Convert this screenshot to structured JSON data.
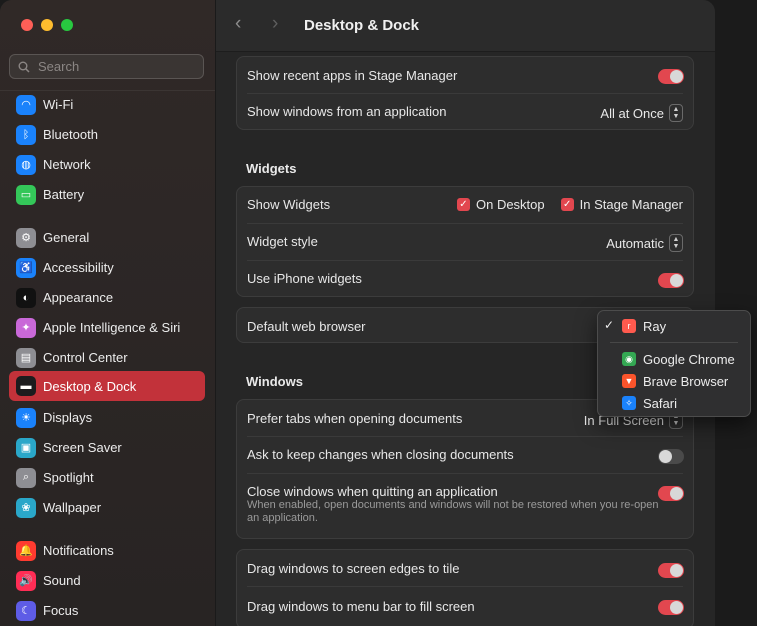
{
  "window": {
    "title": "Desktop & Dock"
  },
  "sidebar": {
    "search_placeholder": "Search",
    "items": [
      {
        "label": "Wi-Fi",
        "icon": "wifi-icon",
        "color": "#1a82fb",
        "glyph": "◠"
      },
      {
        "label": "Bluetooth",
        "icon": "bluetooth-icon",
        "color": "#1a82fb",
        "glyph": "ᛒ"
      },
      {
        "label": "Network",
        "icon": "globe-icon",
        "color": "#1a82fb",
        "glyph": "◍"
      },
      {
        "label": "Battery",
        "icon": "battery-icon",
        "color": "#34c759",
        "glyph": "▭"
      },
      {
        "label": "General",
        "icon": "gear-icon",
        "color": "#8e8e93",
        "glyph": "⚙"
      },
      {
        "label": "Accessibility",
        "icon": "accessibility-icon",
        "color": "#1a82fb",
        "glyph": "♿"
      },
      {
        "label": "Appearance",
        "icon": "appearance-icon",
        "color": "#111111",
        "glyph": "◐"
      },
      {
        "label": "Apple Intelligence & Siri",
        "icon": "siri-icon",
        "color": "#c968d8",
        "glyph": "✦"
      },
      {
        "label": "Control Center",
        "icon": "control-center-icon",
        "color": "#8e8e93",
        "glyph": "▤"
      },
      {
        "label": "Desktop & Dock",
        "icon": "dock-icon",
        "color": "#1c1c1e",
        "glyph": "▬"
      },
      {
        "label": "Displays",
        "icon": "displays-icon",
        "color": "#1a82fb",
        "glyph": "☀"
      },
      {
        "label": "Screen Saver",
        "icon": "screen-saver-icon",
        "color": "#2aa7c9",
        "glyph": "▣"
      },
      {
        "label": "Spotlight",
        "icon": "spotlight-icon",
        "color": "#8e8e93",
        "glyph": "⌕"
      },
      {
        "label": "Wallpaper",
        "icon": "wallpaper-icon",
        "color": "#2aa7c9",
        "glyph": "❀"
      },
      {
        "label": "Notifications",
        "icon": "notifications-icon",
        "color": "#ff3b30",
        "glyph": "🔔"
      },
      {
        "label": "Sound",
        "icon": "sound-icon",
        "color": "#ff2d55",
        "glyph": "🔊"
      },
      {
        "label": "Focus",
        "icon": "focus-icon",
        "color": "#5e5ce6",
        "glyph": "☾"
      }
    ],
    "selected": "Desktop & Dock"
  },
  "stage_group": {
    "rows": [
      {
        "label": "Show recent apps in Stage Manager",
        "toggle": true
      },
      {
        "label": "Show windows from an application",
        "popup": "All at Once"
      }
    ]
  },
  "widgets": {
    "title": "Widgets",
    "show_widgets_label": "Show Widgets",
    "on_desktop_label": "On Desktop",
    "in_stage_manager_label": "In Stage Manager",
    "on_desktop_checked": true,
    "in_stage_manager_checked": true,
    "widget_style_label": "Widget style",
    "widget_style_value": "Automatic",
    "iphone_widgets_label": "Use iPhone widgets",
    "iphone_widgets_on": true
  },
  "browser": {
    "label": "Default web browser"
  },
  "windows": {
    "title": "Windows",
    "prefer_tabs_label": "Prefer tabs when opening documents",
    "prefer_tabs_value": "In Full Screen",
    "ask_keep_label": "Ask to keep changes when closing documents",
    "ask_keep_on": false,
    "close_windows_label": "Close windows when quitting an application",
    "close_windows_desc": "When enabled, open documents and windows will not be restored when you re-open an application.",
    "close_windows_on": true
  },
  "tiling": {
    "edges_label": "Drag windows to screen edges to tile",
    "edges_on": true,
    "menubar_label": "Drag windows to menu bar to fill screen",
    "menubar_on": true
  },
  "browser_menu": {
    "items": [
      {
        "label": "Ray",
        "checked": true,
        "icon": "ray-browser-icon",
        "color": "#ff5a4e",
        "glyph": "r"
      },
      {
        "label": "Google Chrome",
        "checked": false,
        "icon": "chrome-icon",
        "color": "#34a853",
        "glyph": "◉"
      },
      {
        "label": "Brave Browser",
        "checked": false,
        "icon": "brave-icon",
        "color": "#fb542b",
        "glyph": "▼"
      },
      {
        "label": "Safari",
        "checked": false,
        "icon": "safari-icon",
        "color": "#1a82fb",
        "glyph": "✧"
      }
    ],
    "check_glyph": "✓"
  },
  "colors": {
    "accent": "#e2474f",
    "selection": "#c2323a"
  }
}
